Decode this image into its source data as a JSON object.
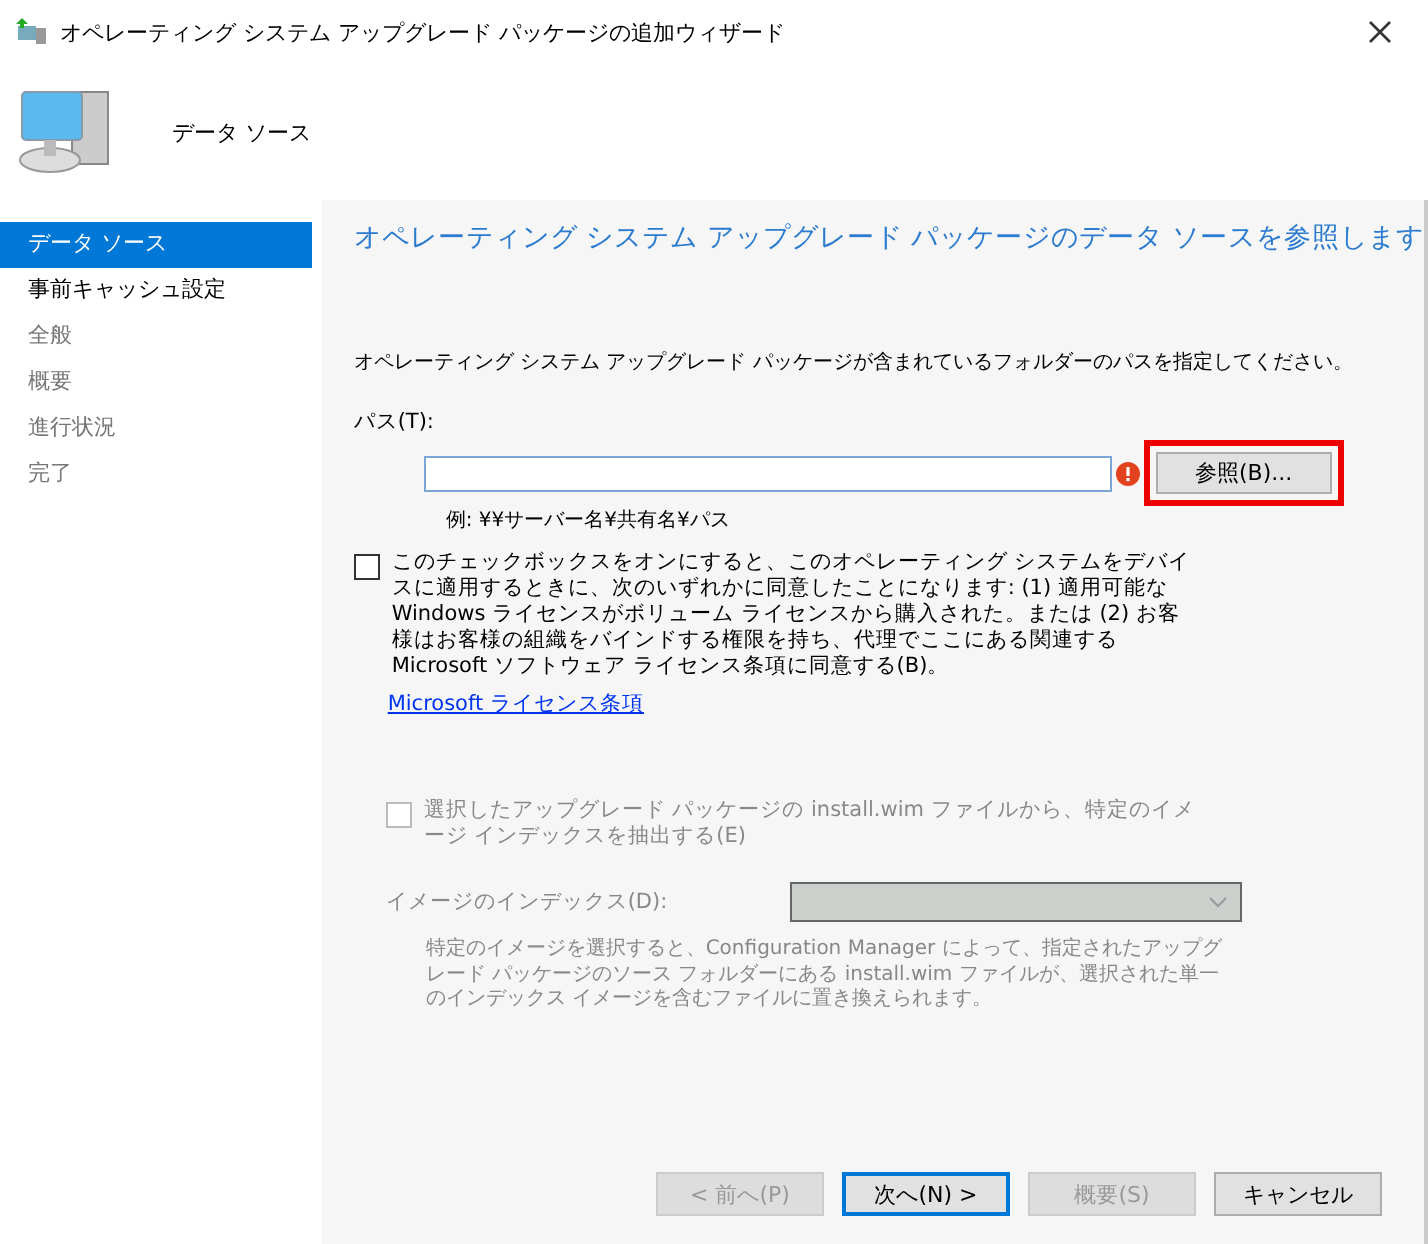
{
  "window": {
    "title": "オペレーティング システム アップグレード パッケージの追加ウィザード"
  },
  "header": {
    "title": "データ ソース"
  },
  "sidebar": {
    "items": [
      {
        "label": "データ ソース",
        "selected": true,
        "disabled": false
      },
      {
        "label": "事前キャッシュ設定",
        "selected": false,
        "disabled": false
      },
      {
        "label": "全般",
        "selected": false,
        "disabled": true
      },
      {
        "label": "概要",
        "selected": false,
        "disabled": true
      },
      {
        "label": "進行状況",
        "selected": false,
        "disabled": true
      },
      {
        "label": "完了",
        "selected": false,
        "disabled": true
      }
    ]
  },
  "content": {
    "heading": "オペレーティング システム アップグレード パッケージのデータ ソースを参照します",
    "instruction": "オペレーティング システム アップグレード パッケージが含まれているフォルダーのパスを指定してください。",
    "path_label": "パス(T):",
    "path_error": true,
    "browse_button": {
      "label": "参照(B)...",
      "highlighted": true
    },
    "path_example": "例: ¥¥サーバー名¥共有名¥パス",
    "license_checkbox": {
      "label": "このチェックボックスをオンにすると、このオペレーティング システムをデバイスに適用するときに、次のいずれかに同意したことになります: (1) 適用可能な Windows ライセンスがボリューム ライセンスから購入された。または (2) お客様はお客様の組織をバインドする権限を持ち、代理でここにある関連する Microsoft ソフトウェア ライセンス条項に同意する(B)。",
      "checked": false,
      "disabled": false
    },
    "license_link": "Microsoft ライセンス条項",
    "extract_checkbox": {
      "label": "選択したアップグレード パッケージの install.wim ファイルから、特定のイメージ インデックスを抽出する(E)",
      "checked": false,
      "disabled": true
    },
    "index_label": "イメージのインデックス(D):",
    "index_disabled": true,
    "index_note": "特定のイメージを選択すると、Configuration Manager によって、指定されたアップグレード パッケージのソース フォルダーにある install.wim ファイルが、選択された単一のインデックス イメージを含むファイルに置き換えられます。"
  },
  "buttons": [
    {
      "label": "< 前へ(P)",
      "disabled": true,
      "default": false
    },
    {
      "label": "次へ(N) >",
      "disabled": false,
      "default": true
    },
    {
      "label": "概要(S)",
      "disabled": true,
      "default": false
    },
    {
      "label": "キャンセル",
      "disabled": false,
      "default": false
    }
  ]
}
